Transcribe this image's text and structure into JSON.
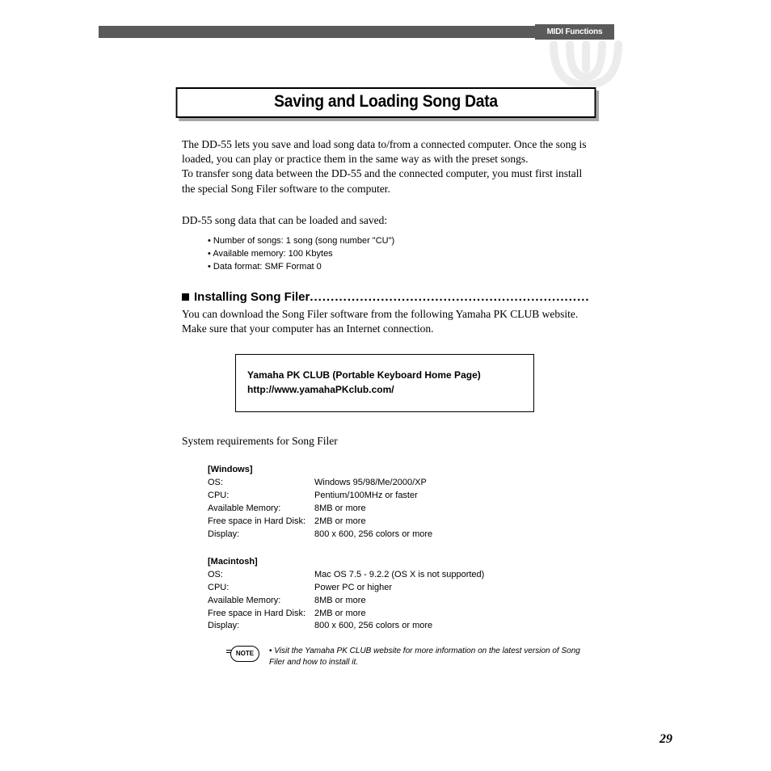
{
  "header": {
    "tab": "MIDI Functions"
  },
  "section_title": "Saving and Loading Song Data",
  "intro": {
    "p1": "The DD-55 lets you save and load song data to/from a connected computer.  Once the song is loaded, you can play or practice them in the same way as with the preset songs.",
    "p2": "To transfer song data between the DD-55 and the connected computer, you must first install the special Song Filer software to the computer."
  },
  "loadable_intro": "DD-55 song data that can be loaded and saved:",
  "loadable_bullets": [
    "Number of songs: 1 song (song number \"CU\")",
    "Available memory: 100 Kbytes",
    "Data format: SMF Format 0"
  ],
  "h2": "Installing Song Filer",
  "after_h2": "You can download the Song Filer software from the following Yamaha PK CLUB website.  Make sure that your computer has an Internet connection.",
  "info_box": {
    "line1": "Yamaha PK CLUB (Portable Keyboard Home Page)",
    "line2": "http://www.yamahaPKclub.com/"
  },
  "sysreq_intro": "System requirements for Song Filer",
  "sysreq": [
    {
      "platform": "[Windows]",
      "rows": [
        {
          "label": "OS:",
          "value": "Windows 95/98/Me/2000/XP"
        },
        {
          "label": "CPU:",
          "value": "Pentium/100MHz or faster"
        },
        {
          "label": "Available Memory:",
          "value": "8MB or more"
        },
        {
          "label": "Free space in Hard Disk:",
          "value": "2MB or more"
        },
        {
          "label": "Display:",
          "value": "800 x 600, 256 colors or more"
        }
      ]
    },
    {
      "platform": "[Macintosh]",
      "rows": [
        {
          "label": "OS:",
          "value": "Mac OS 7.5 - 9.2.2 (OS X is not supported)"
        },
        {
          "label": "CPU:",
          "value": "Power PC or higher"
        },
        {
          "label": "Available Memory:",
          "value": "8MB or more"
        },
        {
          "label": "Free space in Hard Disk:",
          "value": "2MB or more"
        },
        {
          "label": "Display:",
          "value": "800 x 600, 256 colors or more"
        }
      ]
    }
  ],
  "note": {
    "label": "NOTE",
    "text": "Visit the Yamaha PK CLUB website for more information on the latest version of Song Filer and how to install it."
  },
  "page_number": "29"
}
